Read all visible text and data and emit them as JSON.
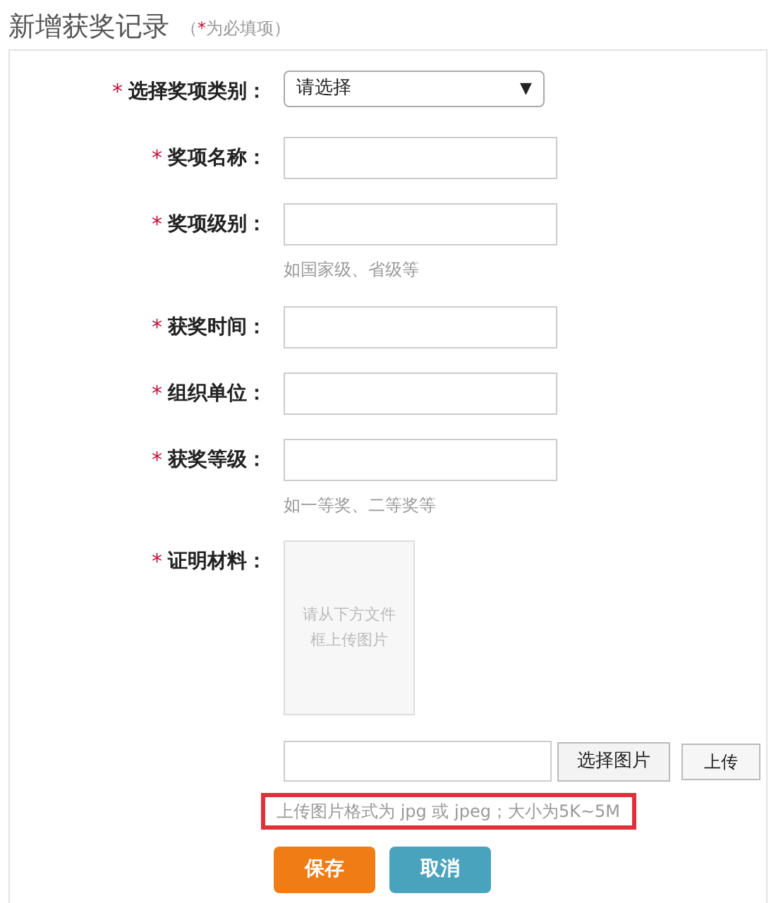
{
  "title": "新增获奖记录",
  "required_note": {
    "open": "（",
    "mark": "*",
    "text": "为必填项",
    "close": "）"
  },
  "fields": [
    {
      "kind": "select",
      "required": true,
      "label": "选择奖项类别：",
      "value": "请选择",
      "arrow": "▼"
    },
    {
      "kind": "text",
      "required": true,
      "label": "奖项名称："
    },
    {
      "kind": "text",
      "required": true,
      "label": "奖项级别：",
      "hint": "如国家级、省级等"
    },
    {
      "kind": "text",
      "required": true,
      "label": "获奖时间："
    },
    {
      "kind": "text",
      "required": true,
      "label": "组织单位："
    },
    {
      "kind": "text",
      "required": true,
      "label": "获奖等级：",
      "hint": "如一等奖、二等奖等"
    },
    {
      "kind": "upload",
      "required": true,
      "label": "证明材料：",
      "preview_text": "请从下方文件框上传图片",
      "choose_button": "选择图片",
      "upload_button": "上传",
      "hint": "上传图片格式为 jpg 或 jpeg；大小为5K~5M",
      "hint_highlighted": true
    }
  ],
  "buttons": [
    {
      "kind": "save",
      "label": "保存"
    },
    {
      "kind": "cancel",
      "label": "取消"
    }
  ]
}
